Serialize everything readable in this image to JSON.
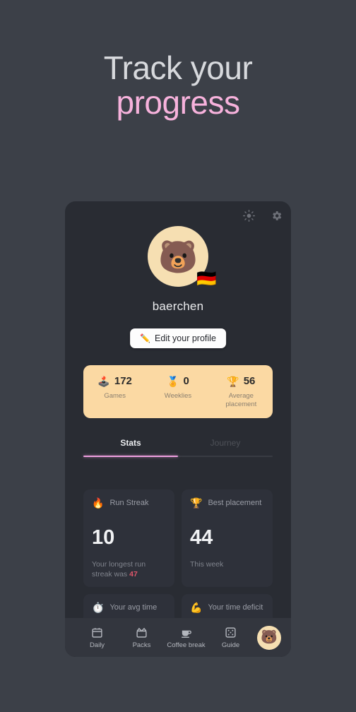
{
  "promo": {
    "line1": "Track your",
    "line2": "progress",
    "line1_color": "#d7d9dd",
    "line2_color": "#f7b2dc"
  },
  "app": {
    "background": "#3c4048",
    "panel_bg": "#292c33",
    "card_bg": "#2e313a",
    "accent_pink": "#ef9fe0",
    "strip_bg": "#fbd9a3"
  },
  "header_icons": [
    {
      "name": "brightness-icon",
      "glyph": "sun"
    },
    {
      "name": "settings-icon",
      "glyph": "gear"
    }
  ],
  "profile": {
    "avatar_emoji": "🐻",
    "flag_emoji": "🇩🇪",
    "username": "baerchen",
    "edit_button": {
      "label": "Edit your profile",
      "emoji": "✏️"
    }
  },
  "summary_stats": [
    {
      "emoji": "🕹️",
      "value": "172",
      "label": "Games"
    },
    {
      "emoji": "🏅",
      "value": "0",
      "label": "Weeklies"
    },
    {
      "emoji": "🏆",
      "value": "56",
      "label": "Average placement"
    }
  ],
  "tabs": [
    {
      "label": "Stats",
      "active": true
    },
    {
      "label": "Journey",
      "active": false
    }
  ],
  "cards": [
    {
      "emoji": "🔥",
      "title": "Run Streak",
      "value": "10",
      "foot_prefix": "Your longest run streak was ",
      "foot_highlight": "47"
    },
    {
      "emoji": "🏆",
      "title": "Best placement",
      "value": "44",
      "foot_prefix": "This week",
      "foot_highlight": ""
    },
    {
      "emoji": "⏱️",
      "title": "Your avg time",
      "value": "",
      "foot_prefix": "",
      "foot_highlight": ""
    },
    {
      "emoji": "💪",
      "title": "Your time deficit",
      "value": "",
      "foot_prefix": "",
      "foot_highlight": ""
    }
  ],
  "bottom_nav": {
    "items": [
      {
        "label": "Daily",
        "icon": "calendar-icon"
      },
      {
        "label": "Packs",
        "icon": "package-icon"
      },
      {
        "label": "Coffee break",
        "icon": "coffee-cup-icon"
      },
      {
        "label": "Guide",
        "icon": "dice-icon"
      }
    ],
    "profile_avatar_emoji": "🐻"
  }
}
